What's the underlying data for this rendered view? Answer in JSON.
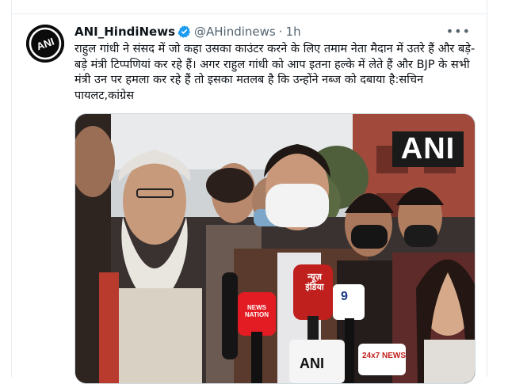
{
  "tweet": {
    "author_name": "ANI_HindiNews",
    "author_handle": "@AHindinews",
    "separator": "·",
    "time": "1h",
    "more_icon": "more-icon",
    "verified_icon": "verified-badge-icon",
    "text": "राहुल गांधी ने संसद में जो कहा उसका काउंटर करने के लिए तमाम नेता मैदान में उतरे हैं और बड़े-बड़े मंत्री टिप्पणियां कर रहे हैं। अगर राहुल गांधी को आप इतना हल्के में लेते हैं और BJP के सभी मंत्री उन पर हमला कर रहे हैं तो इसका मतलब है कि उन्होंने नब्ज को दबाया है:सचिन पायलट,कांग्रेस"
  },
  "avatar": {
    "logo_text": "ANI"
  },
  "media": {
    "watermark": "ANI",
    "mic_labels": [
      "न्यूज़ इंडिया",
      "9",
      "24x7 NEWS",
      "NEWS NATION",
      "ANI"
    ]
  },
  "colors": {
    "verified": "#1d9bf0",
    "text": "#0f1419",
    "muted": "#536471",
    "border": "#cfd9de"
  }
}
